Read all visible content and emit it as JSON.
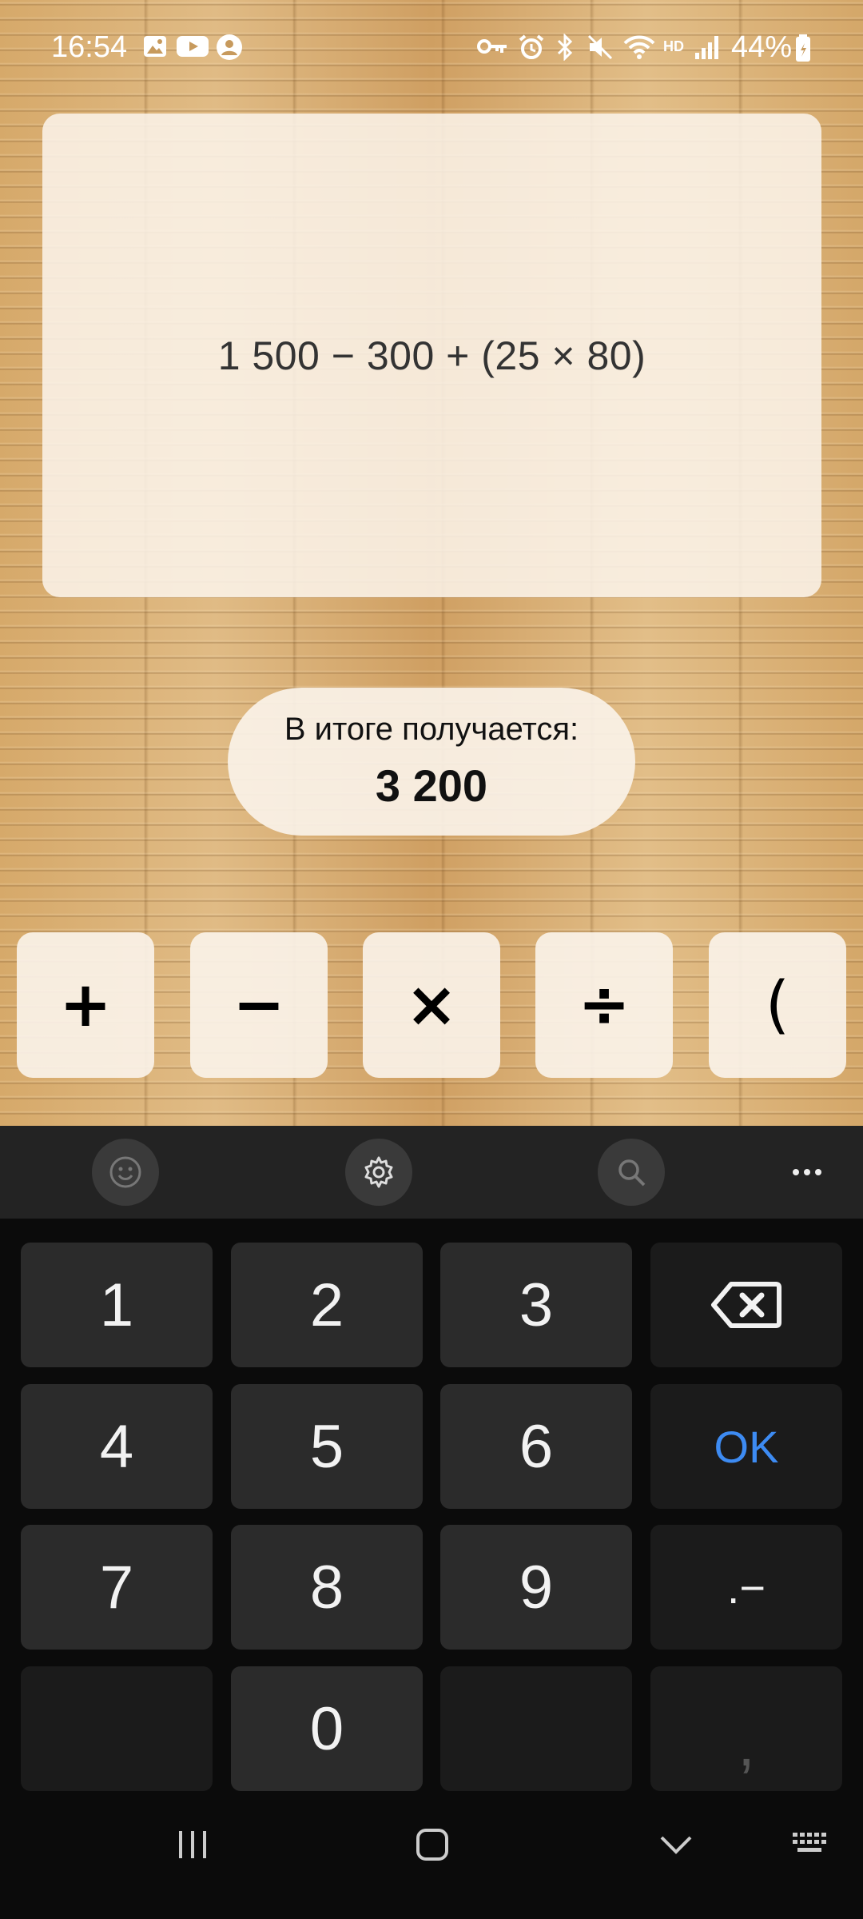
{
  "status_bar": {
    "time": "16:54",
    "battery": "44%",
    "icons": [
      "gallery-icon",
      "youtube-icon",
      "account-icon",
      "key-icon",
      "alarm-icon",
      "bluetooth-icon",
      "mute-icon",
      "wifi-icon",
      "hd-icon",
      "signal-icon",
      "battery-icon"
    ],
    "hd_label": "HD"
  },
  "expression": "1 500 − 300 + (25 × 80)",
  "result": {
    "label": "В итоге получается:",
    "value": "3 200"
  },
  "operators": [
    "+",
    "−",
    "×",
    "÷",
    "("
  ],
  "keyboard": {
    "toolbar_icons": [
      "emoji-icon",
      "settings-icon",
      "search-icon",
      "more-icon"
    ],
    "keys": {
      "k1": "1",
      "k2": "2",
      "k3": "3",
      "k4": "4",
      "k5": "5",
      "k6": "6",
      "k7": "7",
      "k8": "8",
      "k9": "9",
      "k0": "0",
      "ok": "OK",
      "dot_minus": ".−",
      "comma": ","
    }
  },
  "colors": {
    "accent_ok": "#3d8bf2",
    "card_bg": "#faf2e8",
    "key_bg": "#2b2b2b"
  }
}
